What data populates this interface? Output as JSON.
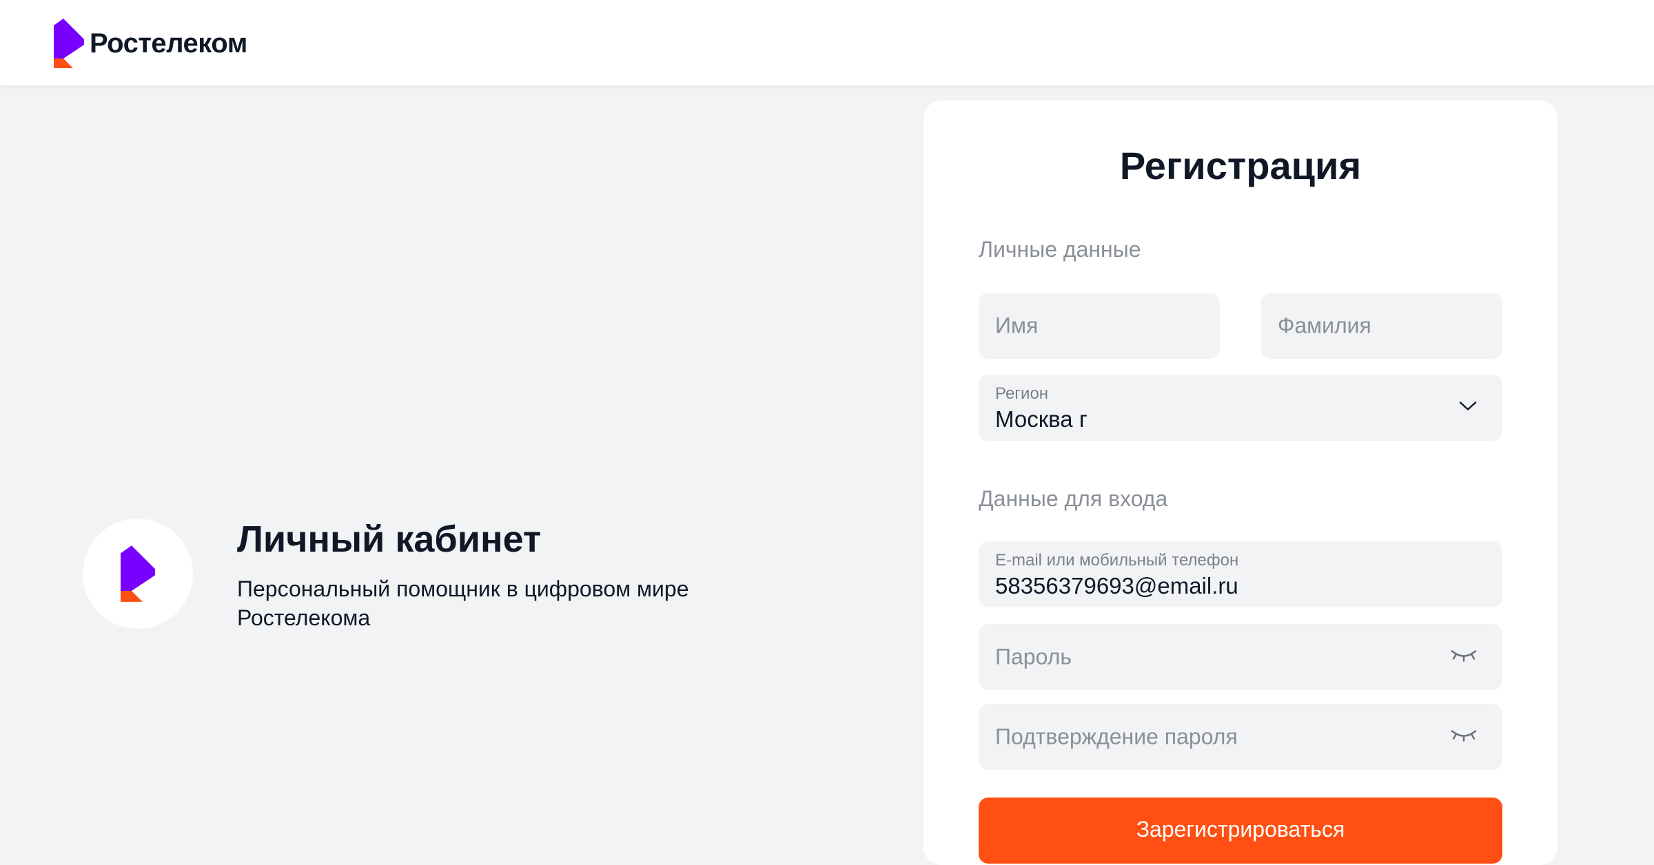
{
  "header": {
    "brand_name": "Ростелеком",
    "logo_icon": "rostelecom-logo"
  },
  "promo": {
    "title": "Личный кабинет",
    "subtitle": "Персональный помощник в цифровом мире Ростелекома",
    "icon": "rostelecom-logo"
  },
  "form": {
    "title": "Регистрация",
    "personal_section": "Личные данные",
    "first_name_placeholder": "Имя",
    "last_name_placeholder": "Фамилия",
    "region_label": "Регион",
    "region_value": "Москва г",
    "login_section": "Данные для входа",
    "login_label": "E-mail или мобильный телефон",
    "login_value": "58356379693@email.ru",
    "password_placeholder": "Пароль",
    "password_confirm_placeholder": "Подтверждение пароля",
    "submit_label": "Зарегистрироваться",
    "icons": {
      "region": "chevron-down-icon",
      "password": "eye-closed-icon"
    }
  },
  "colors": {
    "accent": "#ff4f12",
    "brand_purple": "#7700ff",
    "background": "#f2f3f5",
    "text": "#101828",
    "muted": "#8a8f99"
  }
}
